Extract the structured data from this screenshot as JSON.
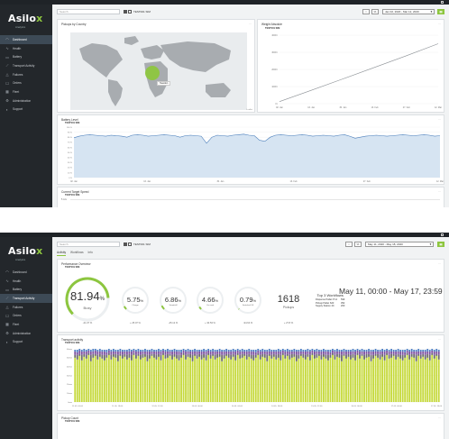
{
  "brand": {
    "logo_main": "Asilo",
    "logo_x": "x",
    "logo_sub": "Analytics"
  },
  "nav_items": [
    {
      "icon": "dashboard-icon",
      "glyph": "◠",
      "label": "Dashboard"
    },
    {
      "icon": "health-icon",
      "glyph": "∿",
      "label": "Health"
    },
    {
      "icon": "battery-icon",
      "glyph": "▭",
      "label": "Battery"
    },
    {
      "icon": "transport-activity-icon",
      "glyph": "⟋",
      "label": "Transport Activity"
    },
    {
      "icon": "failures-icon",
      "glyph": "△",
      "label": "Failures"
    },
    {
      "icon": "orders-icon",
      "glyph": "☐",
      "label": "Orders"
    },
    {
      "icon": "fleet-icon",
      "glyph": "▦",
      "label": "Fleet"
    },
    {
      "icon": "administration-icon",
      "glyph": "⚙",
      "label": "Administration"
    },
    {
      "icon": "support-icon",
      "glyph": "◐",
      "label": "Support"
    }
  ],
  "view1": {
    "search_placeholder": "Search",
    "device": "TEST001 SIM",
    "sort_label": "↕",
    "pct_label": "%",
    "date_range": "Jan 02, 2020 - Mar 12, 2020",
    "pickups_card": {
      "title": "Pickups by Country",
      "tooltip": "Sweden",
      "footer": "Leaflet"
    },
    "weight_card": {
      "title": "Weight Absolute",
      "device": "TEST001 SIM",
      "y_ticks": [
        "4000 t",
        "3000 t",
        "2000 t",
        "1000 t",
        "0 t"
      ],
      "x_ticks": [
        "02. Jan",
        "16. Jan",
        "30. Jan",
        "13. Feb",
        "27. Feb",
        "12. Mar"
      ]
    },
    "battery_card": {
      "title": "Battery Level",
      "device": "TEST001 SIM",
      "y_ticks": [
        "100 %",
        "90 %",
        "80 %",
        "70 %",
        "60 %",
        "50 %",
        "40 %",
        "30 %",
        "20 %",
        "10 %",
        "0 %"
      ],
      "x_ticks": [
        "02. Jan",
        "16. Jan",
        "30. Jan",
        "13. Feb",
        "27. Feb",
        "12. Mar"
      ]
    },
    "speed_card": {
      "title": "Current Target Speed",
      "device": "TEST001 SIM",
      "y_tick": "5 m/s"
    }
  },
  "view2": {
    "search_placeholder": "Search",
    "device": "TEST001 SIM",
    "sort_label": "↕",
    "pct_label": "%",
    "date_range": "May 11, 2020 - May 18, 2020",
    "tabs": [
      "Activity",
      "Workflows",
      "Info"
    ],
    "perf_card": {
      "title": "Performance Overview",
      "device": "TEST001 SIM",
      "date_title": "May 11, 00:00 - May 17, 23:59",
      "busy": {
        "value": "81.94",
        "unit": "%",
        "label": "Busy",
        "change": "-21.07 %",
        "fraction": 0.8194
      },
      "charge": {
        "value": "5.75",
        "unit": "%",
        "label": "Charge",
        "change": "+ 25.07 %",
        "fraction": 0.0575
      },
      "standstill": {
        "value": "6.86",
        "unit": "%",
        "label": "Standstill",
        "change": "-45.12 %",
        "fraction": 0.0686
      },
      "onroad": {
        "value": "4.66",
        "unit": "%",
        "label": "On road",
        "change": "+ 30.53 %",
        "fraction": 0.0466
      },
      "switchedoff": {
        "value": "0.79",
        "unit": "%",
        "label": "Switched Off",
        "change": "-94.64 %",
        "fraction": 0.0079
      },
      "pickups": {
        "value": "1618",
        "label": "Pickups",
        "change": "+ 27.8 %"
      },
      "top3": {
        "title": "Top 3 Workflows",
        "rows": [
          {
            "name": "Dispense Pallet P 12",
            "count": "599"
          },
          {
            "name": "Pickup Pallet S23",
            "count": "352"
          },
          {
            "name": "Supply Station 4C",
            "count": "200"
          }
        ]
      }
    },
    "transport_card": {
      "title": "Transport activity",
      "device": "TEST001 SIM",
      "y_ticks": [
        "60min",
        "50min",
        "40min",
        "30min",
        "20min",
        "10min",
        "0min"
      ],
      "x_ticks": [
        "11.05. 00:00",
        "11.05. 18:00",
        "12.05. 12:00",
        "13.05. 06:00",
        "14.05. 00:00",
        "14.05. 18:00",
        "15.05. 12:00",
        "16.05. 06:00",
        "17.05. 00:00",
        "17.05. 18:00"
      ]
    },
    "pickup_card": {
      "title": "Pickup Count",
      "device": "TEST001 SIM"
    }
  },
  "chart_data": [
    {
      "type": "line",
      "title": "Weight Absolute",
      "series": [
        {
          "name": "TEST001 SIM",
          "x": [
            "02. Jan",
            "16. Jan",
            "30. Jan",
            "13. Feb",
            "27. Feb",
            "12. Mar"
          ],
          "values": [
            120,
            780,
            1450,
            2120,
            2800,
            3500
          ]
        }
      ],
      "ylabel": "",
      "ylim": [
        0,
        4000
      ],
      "grid": true
    },
    {
      "type": "area",
      "title": "Battery Level",
      "series": [
        {
          "name": "TEST001 SIM",
          "values": [
            79,
            82,
            84,
            85,
            84,
            83,
            82,
            84,
            83,
            82,
            80,
            84,
            85,
            84,
            82,
            83,
            84,
            85,
            84,
            83,
            80,
            83,
            84,
            83,
            82,
            68,
            80,
            84,
            83,
            82,
            84,
            85,
            86,
            84,
            83,
            74,
            72,
            80,
            84,
            85,
            84,
            83,
            84,
            85,
            84,
            82,
            83,
            84,
            83,
            82,
            84,
            85,
            82,
            78,
            80,
            82,
            83,
            84,
            83,
            82,
            83,
            84,
            85,
            84,
            83,
            84,
            85,
            84,
            82,
            83
          ]
        }
      ],
      "x_ticks": [
        "02. Jan",
        "16. Jan",
        "30. Jan",
        "13. Feb",
        "27. Feb",
        "12. Mar"
      ],
      "ylim": [
        0,
        100
      ],
      "grid": true
    },
    {
      "type": "bar",
      "title": "Transport activity",
      "stacked": true,
      "series": [
        {
          "name": "Busy",
          "color": "#c5d93a",
          "values": [
            50,
            48,
            52,
            47,
            51,
            49,
            53,
            46,
            50,
            52,
            48,
            51,
            49,
            47,
            50,
            53,
            48,
            51,
            50,
            46,
            52,
            49,
            51,
            48,
            50,
            47,
            53,
            49,
            52,
            48,
            50,
            51,
            46,
            49,
            52,
            50,
            48,
            51,
            47,
            53,
            49,
            50,
            52,
            48,
            51,
            49,
            47,
            50,
            53,
            48,
            51,
            50,
            46,
            52,
            49,
            51,
            48,
            50,
            47,
            53,
            49,
            52,
            48,
            50,
            51,
            46,
            49,
            52,
            50,
            48,
            51,
            47,
            53,
            49,
            50,
            52,
            48,
            51,
            49,
            47,
            50,
            53,
            48,
            51,
            50,
            46,
            52,
            49,
            51,
            48,
            50,
            47,
            53,
            49,
            52,
            48,
            50,
            51,
            46,
            49,
            52,
            50,
            48,
            51,
            47,
            53,
            49,
            50,
            52,
            48,
            51,
            49,
            47,
            50,
            53,
            48,
            51,
            50,
            46,
            52,
            49,
            51,
            48,
            50,
            47,
            53,
            49,
            52,
            48,
            50,
            51,
            46,
            49,
            52,
            50,
            48,
            51,
            47,
            53,
            49,
            50,
            52,
            48,
            51,
            49,
            47,
            50,
            53,
            48,
            51,
            50,
            46,
            52,
            49,
            51,
            48,
            50,
            47,
            53,
            49,
            52,
            48
          ]
        },
        {
          "name": "Charge",
          "color": "#6b6b6b",
          "values": [
            3,
            5,
            2,
            6,
            3,
            4,
            2,
            7,
            4,
            2,
            5,
            3,
            4,
            6,
            3,
            2,
            5,
            3,
            4,
            7,
            2,
            4,
            3,
            5,
            4,
            6,
            2,
            4,
            2,
            5,
            4,
            3,
            7,
            4,
            2,
            4,
            5,
            3,
            6,
            2,
            4,
            4,
            2,
            5,
            3,
            4,
            6,
            3,
            2,
            5,
            3,
            4,
            7,
            2,
            4,
            3,
            5,
            4,
            6,
            2,
            4,
            2,
            5,
            4,
            3,
            7,
            4,
            2,
            4,
            5,
            3,
            6,
            2,
            4,
            4,
            2,
            5,
            3,
            4,
            6,
            3,
            2,
            5,
            3,
            4,
            7,
            2,
            4,
            3,
            5,
            4,
            6,
            2,
            4,
            2,
            5,
            4,
            3,
            7,
            4,
            2,
            4,
            5,
            3,
            6,
            2,
            4,
            4,
            2,
            5,
            3,
            4,
            6,
            3,
            2,
            5,
            3,
            4,
            7,
            2,
            4,
            3,
            5,
            4,
            6,
            2,
            4,
            2,
            5,
            4,
            3,
            7,
            4,
            2,
            4,
            5,
            3,
            6,
            2,
            4,
            4,
            2,
            5,
            3,
            4,
            6,
            3,
            2,
            5,
            3,
            4,
            7,
            2,
            4,
            3,
            5,
            4,
            6,
            2,
            4,
            2,
            5
          ]
        },
        {
          "name": "Standstill",
          "color": "#7a4fa0",
          "values": [
            4,
            3,
            4,
            4,
            3,
            4,
            3,
            4,
            3,
            4,
            4,
            3,
            4,
            4,
            3,
            3,
            4,
            3,
            3,
            4,
            3,
            4,
            3,
            4,
            3,
            4,
            3,
            4,
            3,
            4,
            3,
            3,
            4,
            4,
            3,
            3,
            4,
            3,
            4,
            3,
            4,
            3,
            3,
            4,
            3,
            4,
            4,
            3,
            3,
            4,
            3,
            3,
            4,
            3,
            4,
            3,
            4,
            3,
            4,
            3,
            4,
            3,
            4,
            3,
            3,
            4,
            4,
            3,
            3,
            4,
            3,
            4,
            3,
            4,
            3,
            3,
            4,
            3,
            4,
            4,
            3,
            3,
            4,
            3,
            3,
            4,
            3,
            4,
            3,
            4,
            3,
            4,
            3,
            4,
            3,
            4,
            3,
            3,
            4,
            4,
            3,
            3,
            4,
            3,
            4,
            3,
            4,
            3,
            3,
            4,
            3,
            4,
            4,
            3,
            3,
            4,
            3,
            3,
            4,
            3,
            4,
            3,
            4,
            3,
            4,
            3,
            4,
            3,
            4,
            3,
            3,
            4,
            4,
            3,
            3,
            4,
            3,
            4,
            3,
            4,
            3,
            3,
            4,
            3,
            4,
            4,
            3,
            3,
            4,
            3,
            3,
            4,
            3,
            4,
            3,
            4,
            3,
            4,
            3,
            4,
            3,
            4
          ]
        },
        {
          "name": "On road",
          "color": "#4e7fc4",
          "values": [
            2,
            3,
            2,
            2,
            3,
            2,
            2,
            2,
            3,
            2,
            2,
            3,
            2,
            2,
            3,
            2,
            2,
            3,
            2,
            2,
            3,
            2,
            2,
            2,
            3,
            2,
            2,
            2,
            3,
            2,
            2,
            3,
            2,
            2,
            3,
            2,
            2,
            3,
            2,
            2,
            2,
            3,
            2,
            2,
            3,
            2,
            2,
            3,
            2,
            2,
            3,
            2,
            2,
            3,
            2,
            2,
            2,
            3,
            2,
            2,
            2,
            3,
            2,
            2,
            3,
            2,
            2,
            3,
            2,
            2,
            3,
            2,
            2,
            2,
            3,
            2,
            2,
            3,
            2,
            2,
            3,
            2,
            2,
            3,
            2,
            2,
            3,
            2,
            2,
            2,
            3,
            2,
            2,
            2,
            3,
            2,
            2,
            3,
            2,
            2,
            3,
            2,
            2,
            3,
            2,
            2,
            2,
            3,
            2,
            2,
            3,
            2,
            2,
            3,
            2,
            2,
            3,
            2,
            2,
            3,
            2,
            2,
            2,
            3,
            2,
            2,
            2,
            3,
            2,
            2,
            3,
            2,
            2,
            3,
            2,
            2,
            3,
            2,
            2,
            2,
            3,
            2,
            2,
            3,
            2,
            2,
            3,
            2,
            2,
            3,
            2,
            2,
            3,
            2,
            2,
            2,
            3,
            2,
            2,
            2,
            3,
            2
          ]
        }
      ],
      "x_ticks": [
        "11.05. 00:00",
        "11.05. 18:00",
        "12.05. 12:00",
        "13.05. 06:00",
        "14.05. 00:00",
        "14.05. 18:00",
        "15.05. 12:00",
        "16.05. 06:00",
        "17.05. 00:00",
        "17.05. 18:00"
      ],
      "ylim": [
        0,
        60
      ],
      "ylabel": "min"
    }
  ],
  "colors": {
    "accent": "#8dc63f",
    "sidebar": "#23272b",
    "battery_line": "#4a7ebb",
    "battery_fill": "#d6e4f2",
    "map_bubble": "#8dc63f"
  }
}
